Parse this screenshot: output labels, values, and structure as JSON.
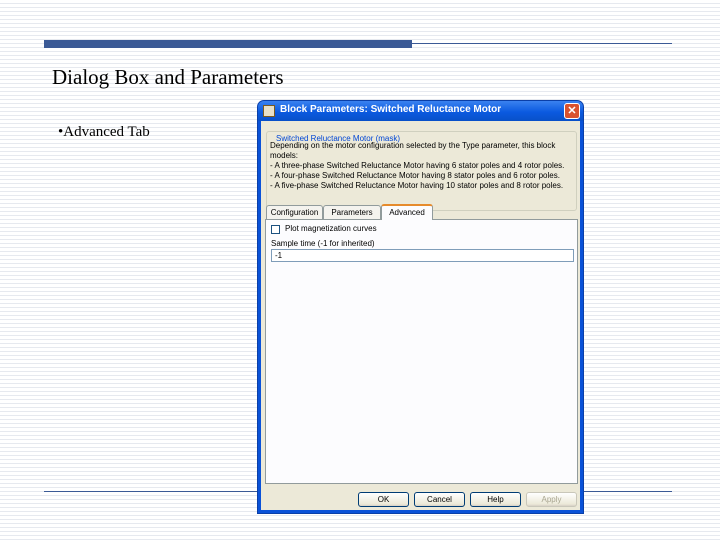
{
  "slide": {
    "title": "Dialog Box and Parameters",
    "bullet": "•Advanced Tab"
  },
  "dialog": {
    "title": "Block Parameters: Switched Reluctance Motor",
    "close_symbol": "✕",
    "group_label": "Switched Reluctance Motor (mask)",
    "description_lines": [
      "Depending on the motor configuration selected by the Type parameter, this block",
      "models:",
      "- A three-phase Switched Reluctance Motor having 6 stator poles and 4 rotor poles.",
      "- A four-phase Switched Reluctance Motor having 8 stator poles and 6 rotor poles.",
      "- A five-phase Switched Reluctance Motor having 10 stator poles and 8 rotor poles."
    ],
    "tabs": [
      {
        "label": "Configuration"
      },
      {
        "label": "Parameters"
      },
      {
        "label": "Advanced"
      }
    ],
    "advanced": {
      "plot_checkbox_label": "Plot magnetization curves",
      "sample_time_label": "Sample time (-1 for inherited)",
      "sample_time_value": "-1"
    },
    "buttons": {
      "ok": "OK",
      "cancel": "Cancel",
      "help": "Help",
      "apply": "Apply"
    }
  }
}
